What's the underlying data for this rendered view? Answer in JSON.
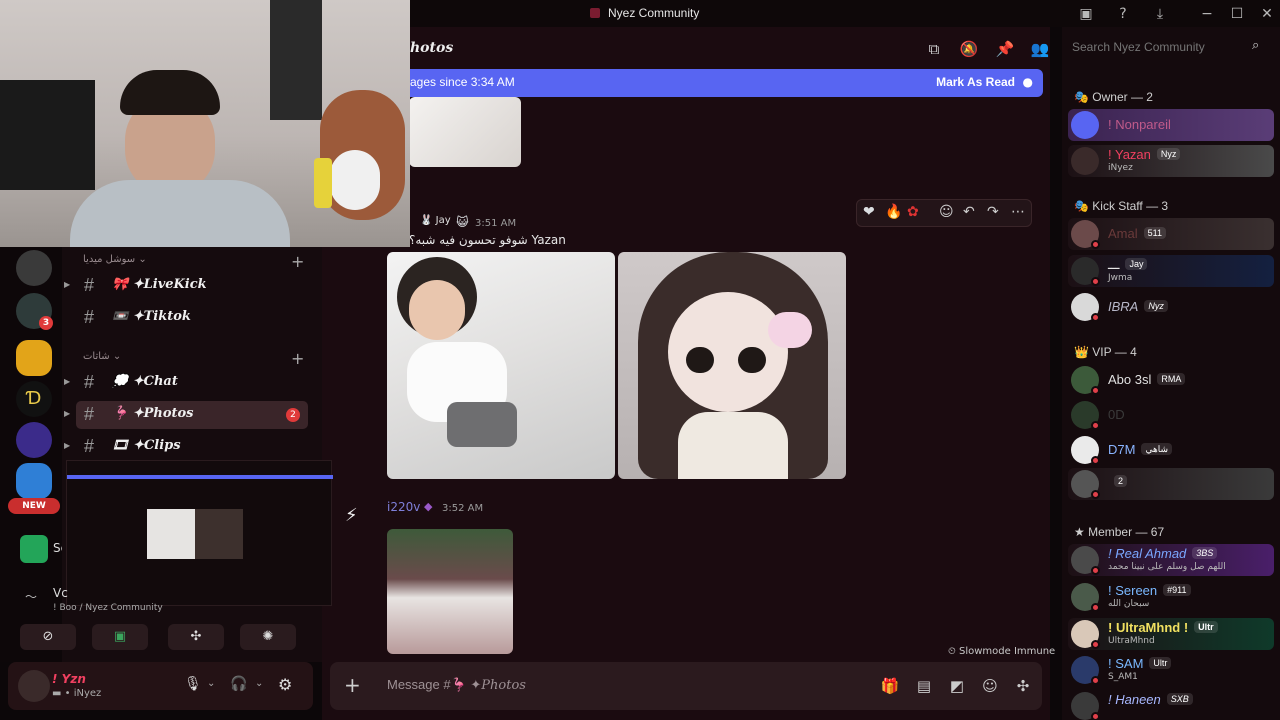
{
  "window": {
    "title": "Nyez Community",
    "icons": [
      "inbox-icon",
      "help-icon",
      "download-icon",
      "minimize-icon",
      "maximize-icon",
      "close-icon"
    ]
  },
  "header": {
    "channel": "hotos",
    "search_placeholder": "Search Nyez Community"
  },
  "banner": {
    "text": "ages since 3:34 AM",
    "mark_read": "Mark As Read"
  },
  "rail": {
    "badge": "3",
    "new_label": "NEW"
  },
  "channels": {
    "categories": [
      {
        "name": "سوشل ميديا",
        "items": [
          "LiveKick",
          "Tiktok"
        ]
      },
      {
        "name": "شاتات",
        "items": [
          "Chat",
          "Photos",
          "Clips"
        ]
      }
    ],
    "photos_unread": "2",
    "partial_labels": [
      "Sc",
      "Vc"
    ],
    "voice_sub": "! Boo / Nyez Community"
  },
  "user": {
    "name": "! Yzn",
    "sub": "iNyez"
  },
  "messages": [
    {
      "author": "o",
      "role": "Jay",
      "time": "3:51 AM",
      "text": "شوفو تحسون فيه شبه؟ Yazan"
    },
    {
      "author": "i220v",
      "time": "3:52 AM"
    }
  ],
  "composer": {
    "placeholder": "Message #",
    "channel": "Photos"
  },
  "slowmode": "Slowmode Immune",
  "members": {
    "groups": [
      {
        "role": "Owner — 2",
        "list": [
          {
            "name": "! Nonpareil",
            "color": "#c05a8a",
            "sub": ""
          },
          {
            "name": "! Yazan",
            "color": "#f04060",
            "tag": "Nyz",
            "sub": "iNyez"
          }
        ]
      },
      {
        "role": "Kick Staff — 3",
        "list": [
          {
            "name": "Amal",
            "color": "#6a3a3a",
            "tag": "511",
            "sub": ""
          },
          {
            "name": "ـــ",
            "color": "#e8e8e8",
            "tag": "Jay",
            "sub": "Jwma"
          },
          {
            "name": "IBRA",
            "color": "#b7b7c8",
            "tag": "Nyz",
            "sub": ""
          }
        ]
      },
      {
        "role": "VIP — 4",
        "list": [
          {
            "name": "Abo 3sl",
            "color": "#e0e0e0",
            "tag": "RMA",
            "sub": ""
          },
          {
            "name": "0D",
            "color": "#3a3a3a",
            "sub": ""
          },
          {
            "name": "D7M",
            "color": "#8ab4ff",
            "tag": "شاهي",
            "sub": ""
          },
          {
            "name": "",
            "color": "#888",
            "tag": "2",
            "sub": ""
          }
        ]
      },
      {
        "role": "Member — 67",
        "list": [
          {
            "name": "! Real Ahmad",
            "color": "#7aa7ff",
            "tag": "3BS",
            "sub": "اللهم صل وسلم على نبينا محمد"
          },
          {
            "name": "! Sereen",
            "color": "#7ab8ff",
            "tag": "#911",
            "sub": "سبحان الله"
          },
          {
            "name": "! UltraMhnd !",
            "color": "#f0e060",
            "tag": "Ultr",
            "sub": "UltraMhnd"
          },
          {
            "name": "! SAM",
            "color": "#7ab8ff",
            "tag": "Ultr",
            "sub": "S_AM1"
          },
          {
            "name": "! Haneen",
            "color": "#a8b8ff",
            "tag": "SXB",
            "sub": ""
          }
        ]
      }
    ]
  }
}
